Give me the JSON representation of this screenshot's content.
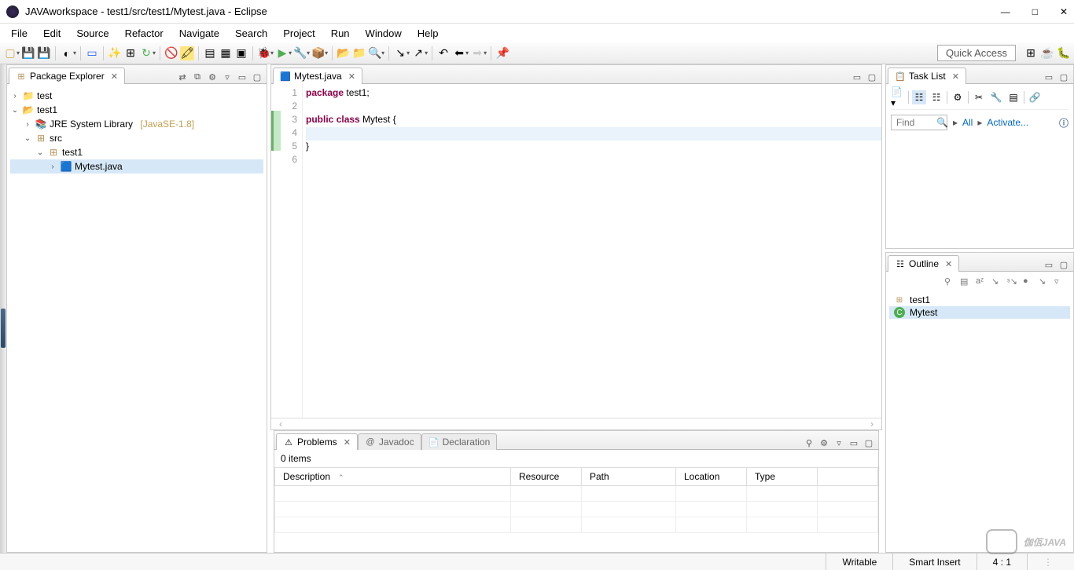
{
  "window": {
    "title": "JAVAworkspace - test1/src/test1/Mytest.java - Eclipse"
  },
  "menubar": [
    "File",
    "Edit",
    "Source",
    "Refactor",
    "Navigate",
    "Search",
    "Project",
    "Run",
    "Window",
    "Help"
  ],
  "quick_access": "Quick Access",
  "package_explorer": {
    "title": "Package Explorer",
    "tree": {
      "test": "test",
      "test1": "test1",
      "jre_label": "JRE System Library",
      "jre_version": "[JavaSE-1.8]",
      "src": "src",
      "pkg": "test1",
      "file": "Mytest.java"
    }
  },
  "editor": {
    "tab": "Mytest.java",
    "lines": [
      "1",
      "2",
      "3",
      "4",
      "5",
      "6"
    ],
    "code": {
      "l1_kw": "package",
      "l1_rest": " test1;",
      "l3_kw1": "public",
      "l3_kw2": "class",
      "l3_rest": " Mytest {",
      "l5": "}"
    }
  },
  "task_list": {
    "title": "Task List",
    "find_placeholder": "Find",
    "all": "All",
    "activate": "Activate..."
  },
  "outline": {
    "title": "Outline",
    "items": [
      "test1",
      "Mytest"
    ]
  },
  "problems": {
    "tabs": [
      "Problems",
      "Javadoc",
      "Declaration"
    ],
    "items_label": "0 items",
    "columns": [
      "Description",
      "Resource",
      "Path",
      "Location",
      "Type"
    ]
  },
  "statusbar": {
    "writable": "Writable",
    "insert": "Smart Insert",
    "position": "4 : 1"
  },
  "watermark": "伽佤JAVA"
}
